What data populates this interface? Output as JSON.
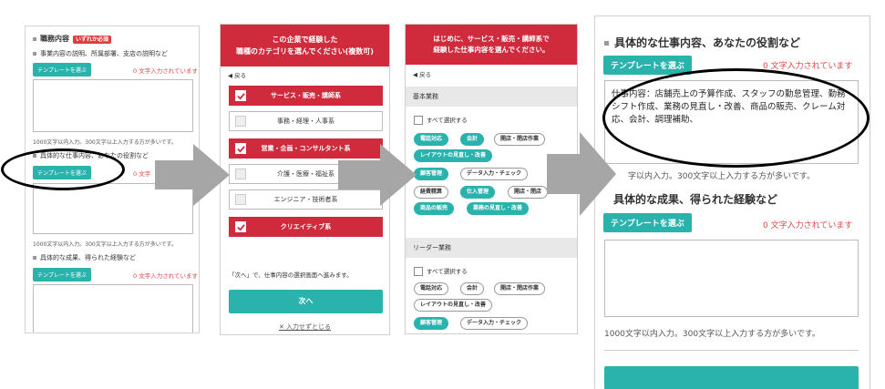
{
  "panel1": {
    "section_title": "職務内容",
    "required_tag": "いずれか必須",
    "q1": "事業内容の説明、所属部署、支店の説明など",
    "template_btn": "テンプレートを選ぶ",
    "count_note": "0 文字入力されています",
    "limit_1000": "1000文字以内入力。300文字以上入力する方が多いです。",
    "q2": "具体的な仕事内容、あなたの役割など",
    "count_note_cut": "0 文字",
    "q3": "具体的な成果、得られた経験など"
  },
  "panel2": {
    "header_line1": "この企業で経験した",
    "header_line2": "職種のカテゴリを選んでください(複数可)",
    "back": "◀ 戻る",
    "options": [
      {
        "label": "サービス・販売・講師系",
        "selected": true
      },
      {
        "label": "事務・経理・人事系",
        "selected": false
      },
      {
        "label": "営業・企画・コンサルタント系",
        "selected": true
      },
      {
        "label": "介護・医療・福祉系",
        "selected": false
      },
      {
        "label": "エンジニア・技術者系",
        "selected": false
      },
      {
        "label": "クリエイティブ系",
        "selected": true
      }
    ],
    "next_note": "「次へ」で、仕事内容の選択画面へ進みます。",
    "next_button": "次へ",
    "close_link": "入力せずとじる"
  },
  "panel3": {
    "header_line1": "はじめに、サービス・販売・講師系で",
    "header_line2": "経験した仕事内容を選んでください。",
    "back": "◀ 戻る",
    "basic_section": "基本業務",
    "select_all": "すべて選択する",
    "basic_chips": [
      {
        "label": "電話対応",
        "on": true
      },
      {
        "label": "会計",
        "on": true
      },
      {
        "label": "開店・閉店作業",
        "on": false
      },
      {
        "label": "レイアウトの見直し・改善",
        "on": true
      },
      {
        "label": "顧客管理",
        "on": true
      },
      {
        "label": "データ入力・チェック",
        "on": false
      },
      {
        "label": "経費精算",
        "on": false
      },
      {
        "label": "仕入管理",
        "on": true
      },
      {
        "label": "開店・閉店",
        "on": false
      },
      {
        "label": "商品の販売",
        "on": true
      },
      {
        "label": "業務の見直し・改善",
        "on": true
      }
    ],
    "leader_section": "リーダー業務",
    "leader_chips": [
      {
        "label": "電話対応",
        "on": false
      },
      {
        "label": "会計",
        "on": false
      },
      {
        "label": "開店・閉店作業",
        "on": false
      },
      {
        "label": "レイアウトの見直し・改善",
        "on": false
      },
      {
        "label": "顧客管理",
        "on": true
      },
      {
        "label": "データ入力・チェック",
        "on": false
      }
    ]
  },
  "panel4": {
    "title1": "具体的な仕事内容、あなたの役割など",
    "template_btn": "テンプレートを選ぶ",
    "count_note": "0 文字入力されています",
    "content": "仕事内容：店舗売上の予算作成、スタッフの勤怠管理、勤務シフト作成、業務の見直し・改善、商品の販売、クレーム対応、会計、調理補助、",
    "limit_300": "字以内入力。300文字以上入力する方が多いです。",
    "title2": "具体的な成果、得られた経験など",
    "limit_1000": "1000文字以内入力。300文字以上入力する方が多いです。"
  },
  "colors": {
    "brand_red": "#cf2b3d",
    "teal": "#2ab3ad",
    "note_red": "#e04545",
    "arrow_gray": "#a6a6a6"
  }
}
